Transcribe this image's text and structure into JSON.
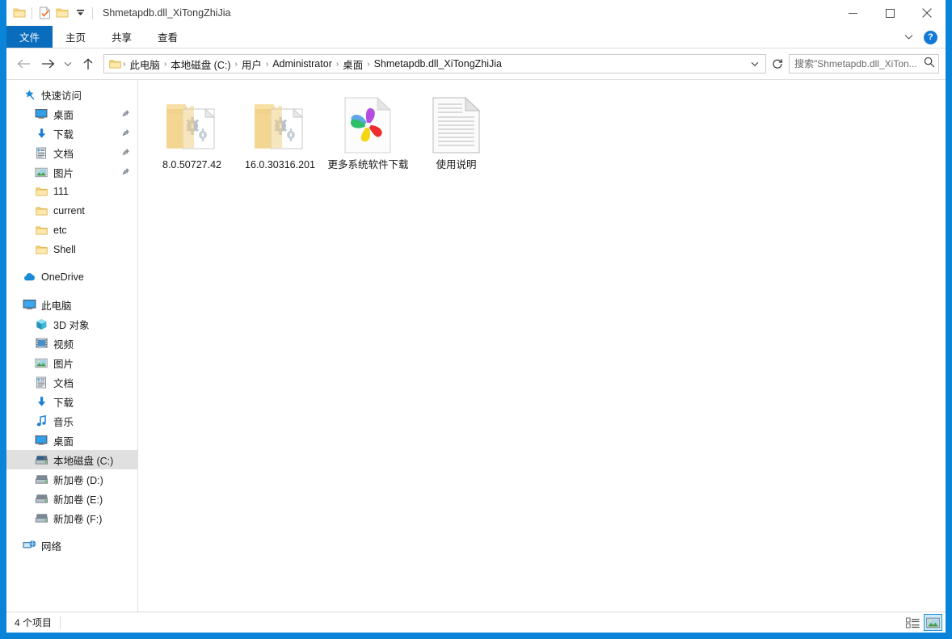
{
  "window": {
    "title": "Shmetapdb.dll_XiTongZhiJia",
    "accent_color": "#0a84d8",
    "controls": {
      "minimize": "minimize-button",
      "maximize": "maximize-button",
      "close": "close-button"
    }
  },
  "quick_access_toolbar": {
    "items": [
      {
        "name": "properties-icon",
        "glyph": "folder"
      },
      {
        "name": "new-folder-icon",
        "glyph": "checked-doc"
      },
      {
        "name": "folder-icon",
        "glyph": "folder"
      },
      {
        "name": "customize-dropdown",
        "glyph": "chevron-down"
      }
    ]
  },
  "ribbon": {
    "tabs": [
      {
        "label": "文件",
        "active": true
      },
      {
        "label": "主页",
        "active": false
      },
      {
        "label": "共享",
        "active": false
      },
      {
        "label": "查看",
        "active": false
      }
    ],
    "collapse_icon": "chevron-down-icon",
    "help_label": "?"
  },
  "navigation": {
    "back_label": "←",
    "forward_label": "→",
    "recent_label": "⌄",
    "up_label": "↑",
    "breadcrumbs": [
      "此电脑",
      "本地磁盘 (C:)",
      "用户",
      "Administrator",
      "桌面",
      "Shmetapdb.dll_XiTongZhiJia"
    ],
    "separator": "›",
    "dropdown_icon": "chevron-down-icon",
    "refresh_icon": "refresh-icon"
  },
  "search": {
    "placeholder": "搜索\"Shmetapdb.dll_XiTon...",
    "value": "",
    "icon": "search-icon"
  },
  "sidebar": {
    "groups": [
      {
        "header": {
          "label": "快速访问",
          "icon": "star-pin-icon",
          "level": 0
        },
        "items": [
          {
            "label": "桌面",
            "icon": "desktop-icon",
            "pinned": true,
            "level": 1
          },
          {
            "label": "下载",
            "icon": "download-icon",
            "pinned": true,
            "level": 1
          },
          {
            "label": "文档",
            "icon": "documents-icon",
            "pinned": true,
            "level": 1
          },
          {
            "label": "图片",
            "icon": "pictures-icon",
            "pinned": true,
            "level": 1
          },
          {
            "label": "111",
            "icon": "folder-icon",
            "pinned": false,
            "level": 1
          },
          {
            "label": "current",
            "icon": "folder-icon",
            "pinned": false,
            "level": 1
          },
          {
            "label": "etc",
            "icon": "folder-icon",
            "pinned": false,
            "level": 1
          },
          {
            "label": "Shell",
            "icon": "folder-icon",
            "pinned": false,
            "level": 1
          }
        ]
      },
      {
        "header": {
          "label": "OneDrive",
          "icon": "onedrive-cloud-icon",
          "level": 0
        },
        "items": []
      },
      {
        "header": {
          "label": "此电脑",
          "icon": "this-pc-icon",
          "level": 0
        },
        "items": [
          {
            "label": "3D 对象",
            "icon": "3d-objects-icon",
            "pinned": false,
            "level": 1
          },
          {
            "label": "视频",
            "icon": "videos-icon",
            "pinned": false,
            "level": 1
          },
          {
            "label": "图片",
            "icon": "pictures-icon",
            "pinned": false,
            "level": 1
          },
          {
            "label": "文档",
            "icon": "documents-icon",
            "pinned": false,
            "level": 1
          },
          {
            "label": "下载",
            "icon": "download-icon",
            "pinned": false,
            "level": 1
          },
          {
            "label": "音乐",
            "icon": "music-icon",
            "pinned": false,
            "level": 1
          },
          {
            "label": "桌面",
            "icon": "desktop-icon",
            "pinned": false,
            "level": 1
          },
          {
            "label": "本地磁盘 (C:)",
            "icon": "local-disk-icon",
            "pinned": false,
            "level": 1,
            "selected": true
          },
          {
            "label": "新加卷 (D:)",
            "icon": "drive-icon",
            "pinned": false,
            "level": 1
          },
          {
            "label": "新加卷 (E:)",
            "icon": "drive-icon",
            "pinned": false,
            "level": 1
          },
          {
            "label": "新加卷 (F:)",
            "icon": "drive-icon",
            "pinned": false,
            "level": 1
          }
        ]
      },
      {
        "header": {
          "label": "网络",
          "icon": "network-icon",
          "level": 0
        },
        "items": []
      }
    ]
  },
  "files": [
    {
      "name": "8.0.50727.42",
      "type": "folder-with-gears",
      "icon": "folder-settings-icon"
    },
    {
      "name": "16.0.30316.201",
      "type": "folder-with-gears",
      "icon": "folder-settings-icon"
    },
    {
      "name": "更多系统软件下载",
      "type": "html-document",
      "icon": "pinwheel-browser-icon"
    },
    {
      "name": "使用说明",
      "type": "text-document",
      "icon": "text-file-icon"
    }
  ],
  "status": {
    "item_count": "4 个项目",
    "views": [
      {
        "name": "details-view",
        "active": false
      },
      {
        "name": "large-icons-view",
        "active": true
      }
    ]
  }
}
